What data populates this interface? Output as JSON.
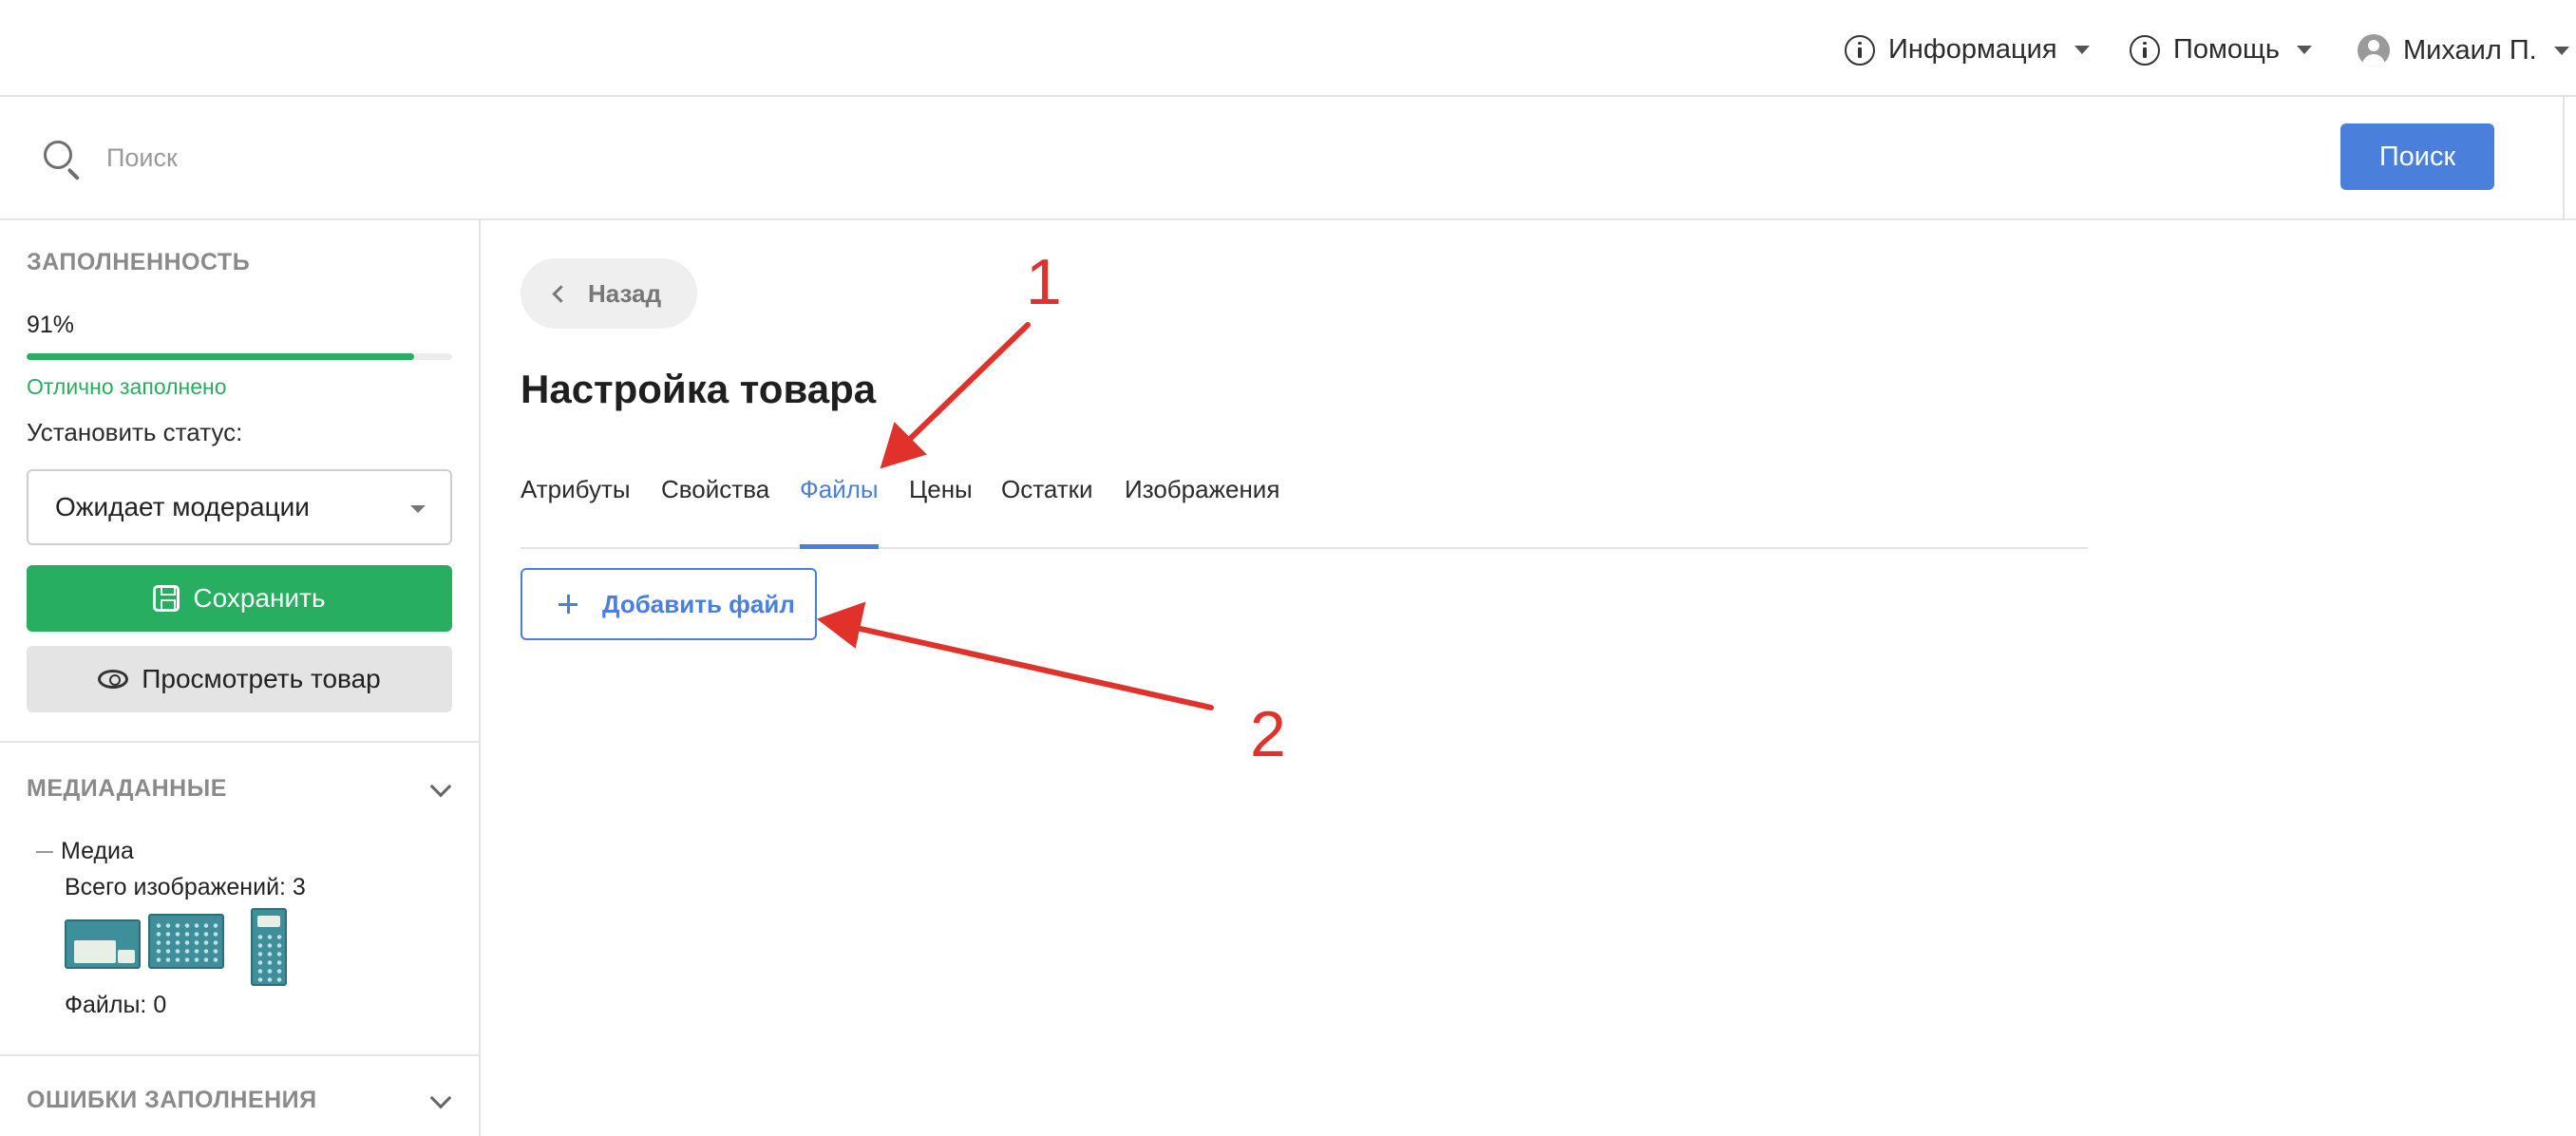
{
  "header": {
    "menu": [
      {
        "label": "Информация",
        "icon": "info-icon"
      },
      {
        "label": "Помощь",
        "icon": "info-icon"
      },
      {
        "label": "Михаил П.",
        "icon": "user-icon"
      }
    ]
  },
  "search": {
    "placeholder": "Поиск",
    "button_label": "Поиск"
  },
  "sidebar": {
    "completeness": {
      "title": "ЗАПОЛНЕННОСТЬ",
      "percent_label": "91%",
      "progress": 0.91,
      "status_text": "Отлично заполнено"
    },
    "set_status_label": "Установить статус:",
    "status_value": "Ожидает модерации",
    "save_label": "Сохранить",
    "view_label": "Просмотреть товар",
    "media": {
      "title": "МЕДИАДАННЫЕ",
      "group_label": "Медиа",
      "total_images": "Всего изображений: 3",
      "thumbnails": [
        "calculator-image",
        "calculator-image",
        "calculator-image"
      ],
      "files_count": "Файлы: 0"
    },
    "errors": {
      "title": "ОШИБКИ ЗАПОЛНЕНИЯ"
    }
  },
  "main": {
    "back_label": "Назад",
    "title": "Настройка товара",
    "tabs": [
      {
        "label": "Атрибуты",
        "active": false
      },
      {
        "label": "Свойства",
        "active": false
      },
      {
        "label": "Файлы",
        "active": true
      },
      {
        "label": "Цены",
        "active": false
      },
      {
        "label": "Остатки",
        "active": false
      },
      {
        "label": "Изображения",
        "active": false
      }
    ],
    "add_file_label": "Добавить файл"
  },
  "annotations": {
    "marker_1": "1",
    "marker_2": "2",
    "color": "#e0312b"
  },
  "colors": {
    "accent": "#4a80dc",
    "success": "#27ae60"
  }
}
